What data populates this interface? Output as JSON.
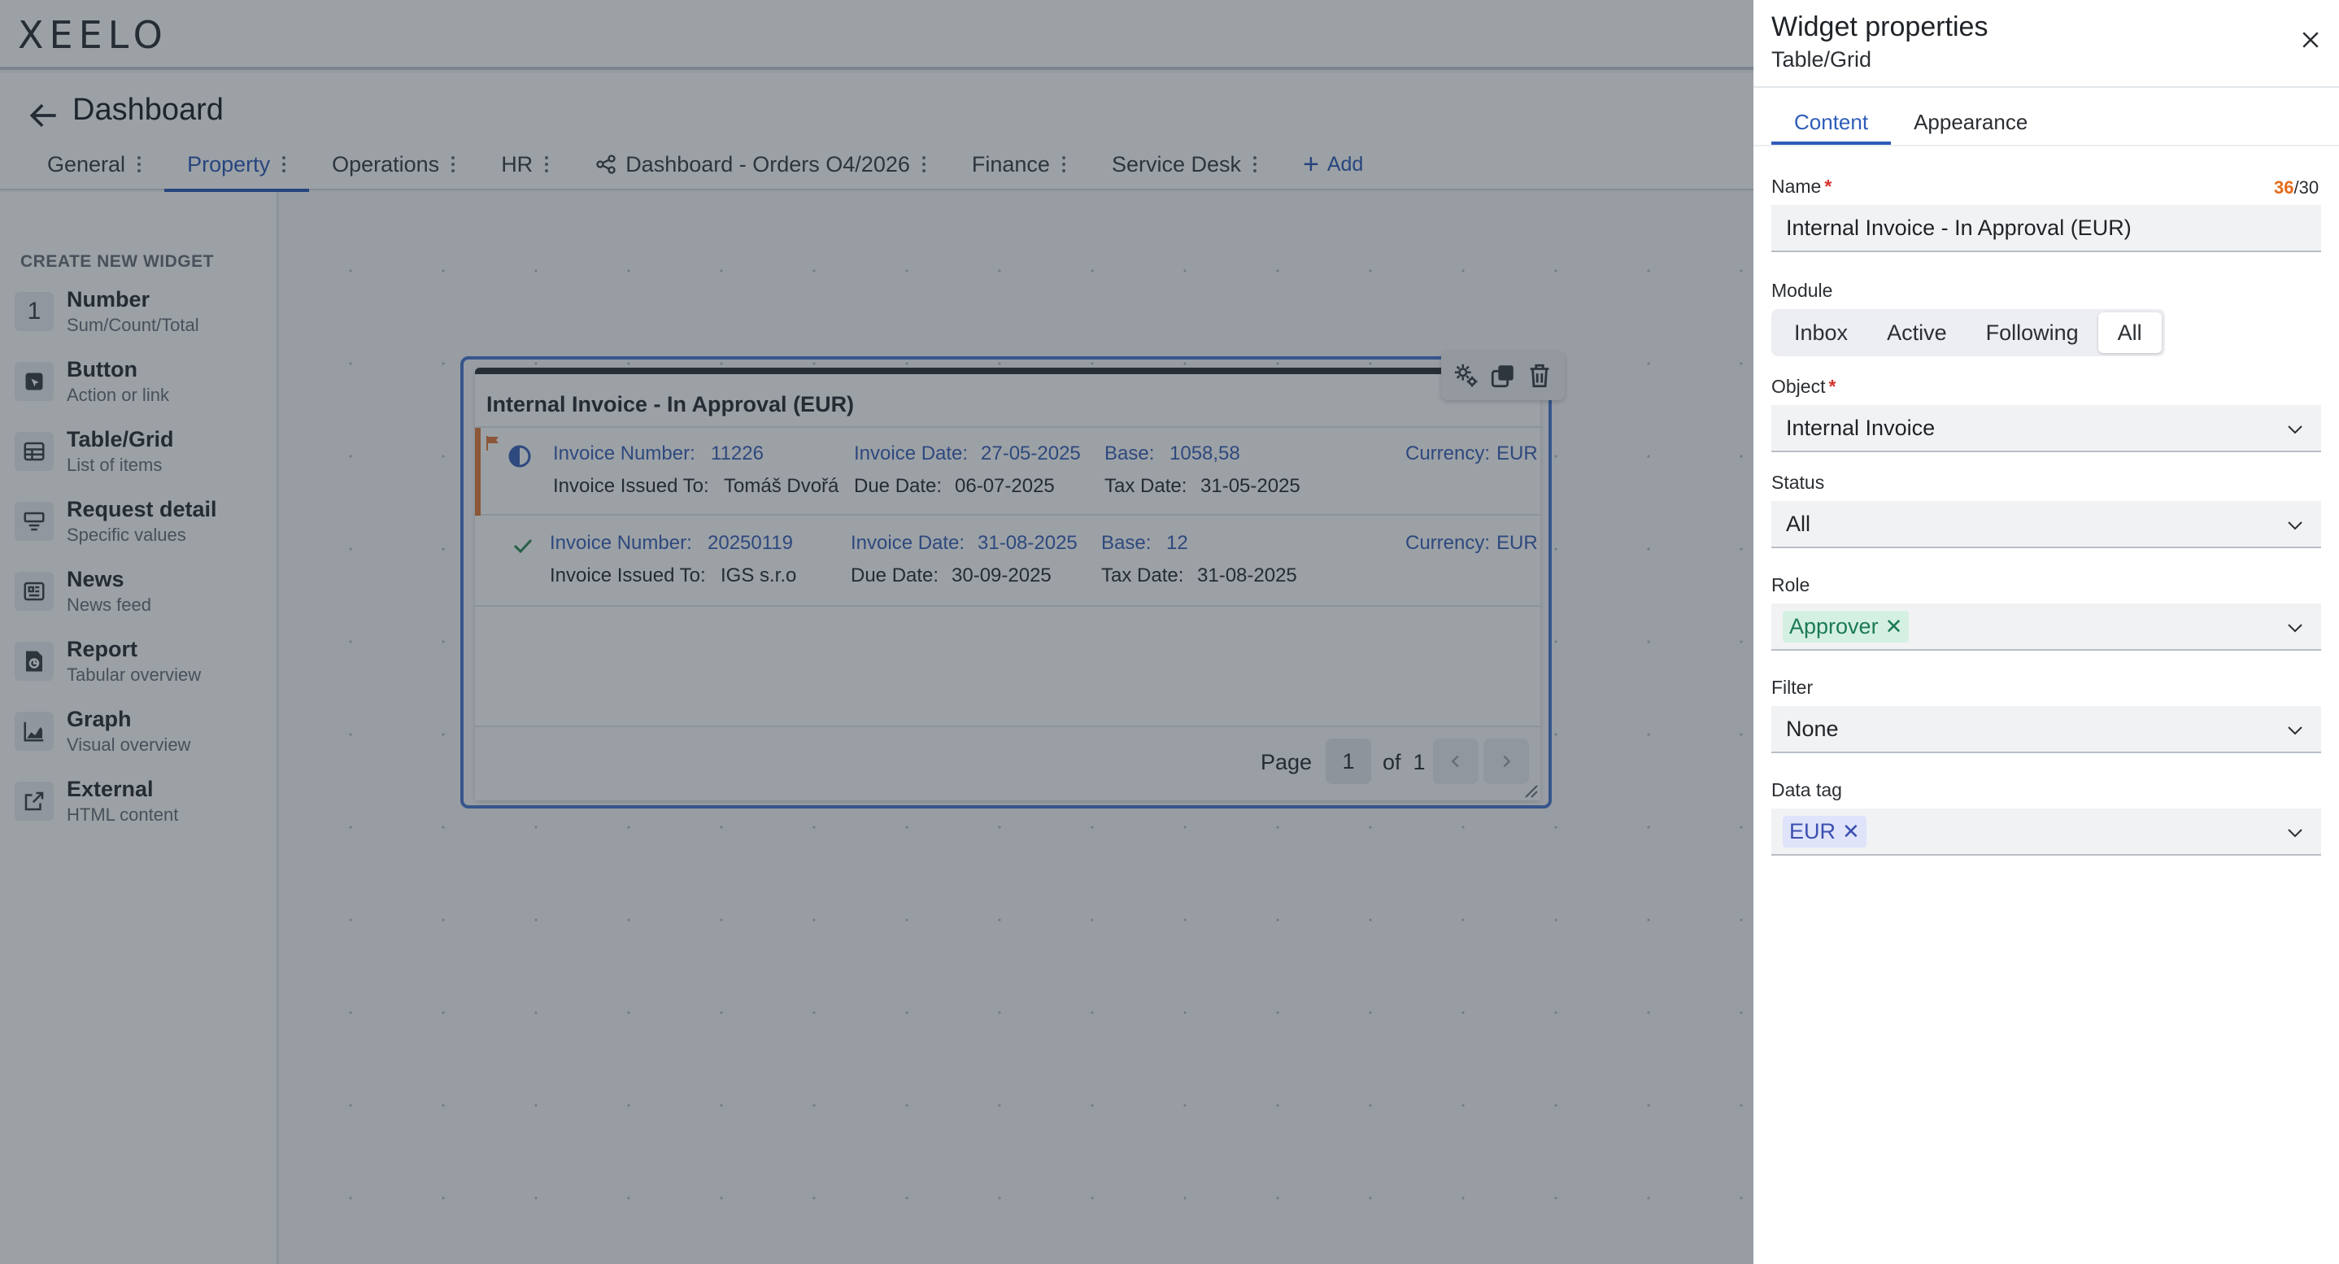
{
  "app": {
    "logo": "XEELO"
  },
  "header": {
    "title": "Dashboard"
  },
  "tabs": [
    {
      "label": "General"
    },
    {
      "label": "Property"
    },
    {
      "label": "Operations"
    },
    {
      "label": "HR"
    },
    {
      "label": "Dashboard - Orders O4/2026"
    },
    {
      "label": "Finance"
    },
    {
      "label": "Service Desk"
    }
  ],
  "add_tab_label": "Add",
  "sidebar": {
    "heading": "CREATE NEW WIDGET",
    "items": [
      {
        "title": "Number",
        "subtitle": "Sum/Count/Total",
        "icon": "number-one-icon",
        "glyph": "1"
      },
      {
        "title": "Button",
        "subtitle": "Action or link",
        "icon": "button-icon"
      },
      {
        "title": "Table/Grid",
        "subtitle": "List of items",
        "icon": "table-icon"
      },
      {
        "title": "Request detail",
        "subtitle": "Specific values",
        "icon": "request-detail-icon"
      },
      {
        "title": "News",
        "subtitle": "News feed",
        "icon": "news-icon"
      },
      {
        "title": "Report",
        "subtitle": "Tabular overview",
        "icon": "report-icon"
      },
      {
        "title": "Graph",
        "subtitle": "Visual overview",
        "icon": "graph-icon"
      },
      {
        "title": "External",
        "subtitle": "HTML content",
        "icon": "external-link-icon"
      }
    ]
  },
  "widget": {
    "title": "Internal Invoice - In Approval (EUR)",
    "rows": [
      {
        "status_icon": "half-circle-icon",
        "flagged": true,
        "invoice_number_label": "Invoice Number:",
        "invoice_number": "11226",
        "invoice_date_label": "Invoice Date:",
        "invoice_date": "27-05-2025",
        "base_label": "Base:",
        "base": "1058,58",
        "currency_label": "Currency:",
        "currency": "EUR",
        "issued_to_label": "Invoice Issued To:",
        "issued_to": "Tomáš Dvořá",
        "due_date_label": "Due Date:",
        "due_date": "06-07-2025",
        "tax_date_label": "Tax Date:",
        "tax_date": "31-05-2025"
      },
      {
        "status_icon": "checkmark-icon",
        "flagged": false,
        "invoice_number_label": "Invoice Number:",
        "invoice_number": "20250119",
        "invoice_date_label": "Invoice Date:",
        "invoice_date": "31-08-2025",
        "base_label": "Base:",
        "base": "12",
        "currency_label": "Currency:",
        "currency": "EUR",
        "issued_to_label": "Invoice Issued To:",
        "issued_to": "IGS s.r.o",
        "due_date_label": "Due Date:",
        "due_date": "30-09-2025",
        "tax_date_label": "Tax Date:",
        "tax_date": "31-08-2025"
      }
    ],
    "pager": {
      "page_label": "Page",
      "current": "1",
      "of_label": "of",
      "total": "1"
    }
  },
  "panel": {
    "title": "Widget properties",
    "subtitle": "Table/Grid",
    "tabs": [
      {
        "label": "Content"
      },
      {
        "label": "Appearance"
      }
    ],
    "name": {
      "label": "Name",
      "value": "Internal Invoice - In Approval (EUR)",
      "count": "36",
      "max": "/30"
    },
    "module": {
      "label": "Module",
      "options": [
        "Inbox",
        "Active",
        "Following",
        "All"
      ],
      "selected": "All"
    },
    "object": {
      "label": "Object",
      "value": "Internal Invoice"
    },
    "status": {
      "label": "Status",
      "value": "All"
    },
    "role": {
      "label": "Role",
      "chip": "Approver"
    },
    "filter": {
      "label": "Filter",
      "value": "None"
    },
    "data_tag": {
      "label": "Data tag",
      "chip": "EUR"
    }
  },
  "colors": {
    "accent": "#2f5cb8",
    "flag": "#e07b3c",
    "counter_over": "#e56b1c",
    "required": "#d4322c"
  }
}
